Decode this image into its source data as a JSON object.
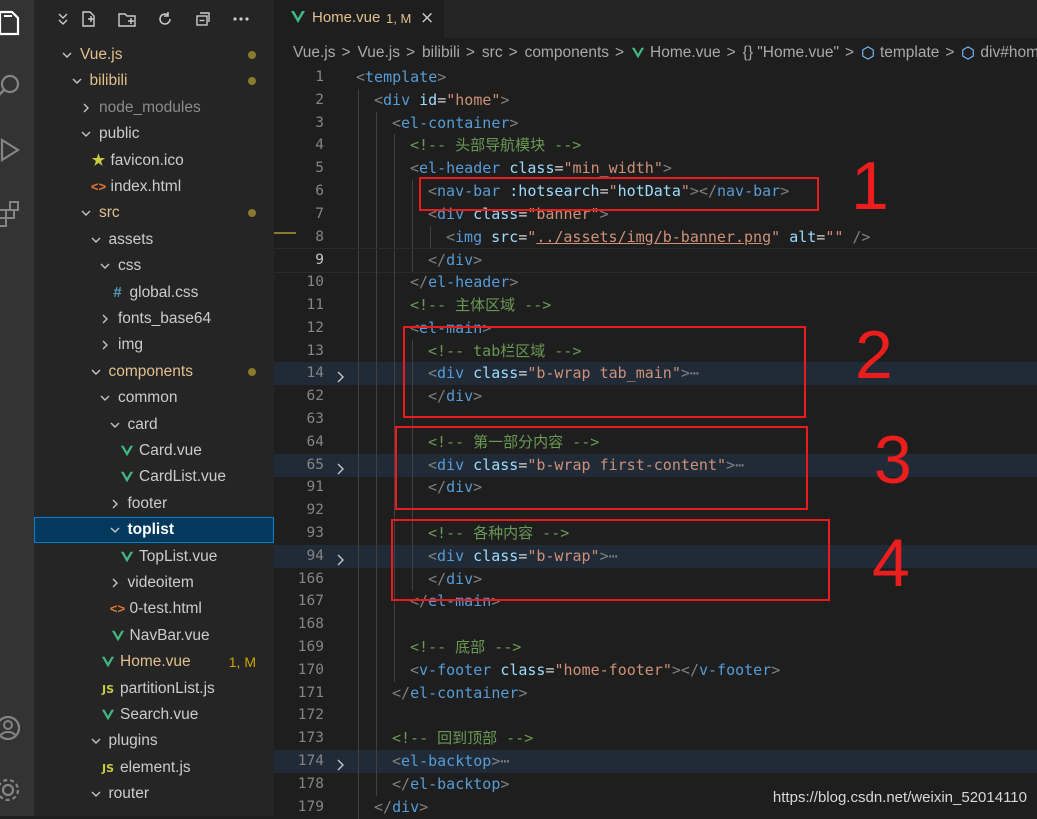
{
  "activity_bar": {
    "icons": [
      "explorer-icon",
      "search-icon",
      "run-debug-icon",
      "extensions-icon",
      "account-icon",
      "manage-gear-icon"
    ]
  },
  "explorer": {
    "toolbar_icons": [
      "collapse-icon",
      "new-file-icon",
      "new-folder-icon",
      "refresh-icon",
      "collapse-all-icon",
      "more-icon"
    ],
    "tree": [
      {
        "label": "Vue.js",
        "type": "folder",
        "open": true,
        "depth": 0,
        "status": "modified",
        "color": "#e2c08d"
      },
      {
        "label": "bilibili",
        "type": "folder",
        "open": true,
        "depth": 1,
        "status": "modified",
        "color": "#e2c08d"
      },
      {
        "label": "node_modules",
        "type": "folder",
        "open": false,
        "depth": 2,
        "color": "#8c8c8c"
      },
      {
        "label": "public",
        "type": "folder",
        "open": true,
        "depth": 2,
        "color": "#cccccc"
      },
      {
        "label": "favicon.ico",
        "type": "file",
        "icon": "star",
        "depth": 3,
        "color": "#cccccc"
      },
      {
        "label": "index.html",
        "type": "file",
        "icon": "html",
        "depth": 3,
        "color": "#cccccc"
      },
      {
        "label": "src",
        "type": "folder",
        "open": true,
        "depth": 2,
        "status": "modified",
        "color": "#e2c08d"
      },
      {
        "label": "assets",
        "type": "folder",
        "open": true,
        "depth": 3,
        "color": "#cccccc"
      },
      {
        "label": "css",
        "type": "folder",
        "open": true,
        "depth": 4,
        "color": "#cccccc"
      },
      {
        "label": "global.css",
        "type": "file",
        "icon": "css",
        "depth": 5,
        "color": "#cccccc"
      },
      {
        "label": "fonts_base64",
        "type": "folder",
        "open": false,
        "depth": 4,
        "color": "#cccccc"
      },
      {
        "label": "img",
        "type": "folder",
        "open": false,
        "depth": 4,
        "color": "#cccccc"
      },
      {
        "label": "components",
        "type": "folder",
        "open": true,
        "depth": 3,
        "status": "modified",
        "color": "#e2c08d"
      },
      {
        "label": "common",
        "type": "folder",
        "open": true,
        "depth": 4,
        "color": "#cccccc"
      },
      {
        "label": "card",
        "type": "folder",
        "open": true,
        "depth": 5,
        "color": "#cccccc"
      },
      {
        "label": "Card.vue",
        "type": "file",
        "icon": "vue",
        "depth": 6,
        "color": "#cccccc"
      },
      {
        "label": "CardList.vue",
        "type": "file",
        "icon": "vue",
        "depth": 6,
        "color": "#cccccc"
      },
      {
        "label": "footer",
        "type": "folder",
        "open": false,
        "depth": 5,
        "color": "#cccccc"
      },
      {
        "label": "toplist",
        "type": "folder",
        "open": true,
        "depth": 5,
        "selected": true,
        "color": "#ffffff"
      },
      {
        "label": "TopList.vue",
        "type": "file",
        "icon": "vue",
        "depth": 6,
        "color": "#cccccc"
      },
      {
        "label": "videoitem",
        "type": "folder",
        "open": false,
        "depth": 5,
        "color": "#cccccc"
      },
      {
        "label": "0-test.html",
        "type": "file",
        "icon": "html",
        "depth": 5,
        "color": "#cccccc"
      },
      {
        "label": "NavBar.vue",
        "type": "file",
        "icon": "vue",
        "depth": 5,
        "color": "#cccccc"
      },
      {
        "label": "Home.vue",
        "type": "file",
        "icon": "vue",
        "depth": 4,
        "color": "#e2c08d",
        "badge": "1, M"
      },
      {
        "label": "partitionList.js",
        "type": "file",
        "icon": "js",
        "depth": 4,
        "color": "#cccccc"
      },
      {
        "label": "Search.vue",
        "type": "file",
        "icon": "vue",
        "depth": 4,
        "color": "#cccccc"
      },
      {
        "label": "plugins",
        "type": "folder",
        "open": true,
        "depth": 3,
        "color": "#cccccc"
      },
      {
        "label": "element.js",
        "type": "file",
        "icon": "js",
        "depth": 4,
        "color": "#cccccc"
      },
      {
        "label": "router",
        "type": "folder",
        "open": true,
        "depth": 3,
        "color": "#cccccc"
      }
    ]
  },
  "tab": {
    "label": "Home.vue",
    "badge": "1, M",
    "close": "×"
  },
  "breadcrumb": [
    "Vue.js",
    "Vue.js",
    "bilibili",
    "src",
    "components",
    "Home.vue",
    "{} \"Home.vue\"",
    "template",
    "div#home"
  ],
  "breadcrumb_sep": ">",
  "code_lines": [
    {
      "n": "1",
      "indent": 0,
      "tokens": [
        [
          "br",
          "<"
        ],
        [
          "tag",
          "template"
        ],
        [
          "br",
          ">"
        ]
      ]
    },
    {
      "n": "2",
      "indent": 1,
      "tokens": [
        [
          "br",
          "<"
        ],
        [
          "tag",
          "div"
        ],
        [
          "txt",
          " "
        ],
        [
          "attr",
          "id"
        ],
        [
          "txt",
          "="
        ],
        [
          "str",
          "\"home\""
        ],
        [
          "br",
          ">"
        ]
      ]
    },
    {
      "n": "3",
      "indent": 2,
      "tokens": [
        [
          "br",
          "<"
        ],
        [
          "tag",
          "el-container"
        ],
        [
          "br",
          ">"
        ]
      ]
    },
    {
      "n": "4",
      "indent": 3,
      "tokens": [
        [
          "com",
          "<!-- 头部导航模块 -->"
        ]
      ]
    },
    {
      "n": "5",
      "indent": 3,
      "tokens": [
        [
          "br",
          "<"
        ],
        [
          "tag",
          "el-header"
        ],
        [
          "txt",
          " "
        ],
        [
          "attr",
          "class"
        ],
        [
          "txt",
          "="
        ],
        [
          "str",
          "\"min_width\""
        ],
        [
          "br",
          ">"
        ]
      ]
    },
    {
      "n": "6",
      "indent": 4,
      "tokens": [
        [
          "br",
          "<"
        ],
        [
          "tag",
          "nav-bar"
        ],
        [
          "txt",
          " "
        ],
        [
          "attr",
          ":hotsearch"
        ],
        [
          "txt",
          "="
        ],
        [
          "str",
          "\""
        ],
        [
          "attr",
          "hotData"
        ],
        [
          "str",
          "\""
        ],
        [
          "br",
          "></"
        ],
        [
          "tag",
          "nav-bar"
        ],
        [
          "br",
          ">"
        ]
      ]
    },
    {
      "n": "7",
      "indent": 4,
      "tokens": [
        [
          "br",
          "<"
        ],
        [
          "tag",
          "div"
        ],
        [
          "txt",
          " "
        ],
        [
          "attr",
          "class"
        ],
        [
          "txt",
          "="
        ],
        [
          "str",
          "\"banner\""
        ],
        [
          "br",
          ">"
        ]
      ]
    },
    {
      "n": "8",
      "indent": 5,
      "tokens": [
        [
          "br",
          "<"
        ],
        [
          "tag",
          "img"
        ],
        [
          "txt",
          " "
        ],
        [
          "attr",
          "src"
        ],
        [
          "txt",
          "="
        ],
        [
          "str",
          "\""
        ],
        [
          "link",
          "../assets/img/b-banner.png"
        ],
        [
          "str",
          "\""
        ],
        [
          "txt",
          " "
        ],
        [
          "attr",
          "alt"
        ],
        [
          "txt",
          "="
        ],
        [
          "str",
          "\"\""
        ],
        [
          "txt",
          " "
        ],
        [
          "br",
          "/>"
        ]
      ]
    },
    {
      "n": "9",
      "indent": 4,
      "cur": true,
      "tokens": [
        [
          "br",
          "</"
        ],
        [
          "tag",
          "div"
        ],
        [
          "br",
          ">"
        ]
      ]
    },
    {
      "n": "10",
      "indent": 3,
      "tokens": [
        [
          "br",
          "</"
        ],
        [
          "tag",
          "el-header"
        ],
        [
          "br",
          ">"
        ]
      ]
    },
    {
      "n": "11",
      "indent": 3,
      "tokens": [
        [
          "com",
          "<!-- 主体区域 -->"
        ]
      ]
    },
    {
      "n": "12",
      "indent": 3,
      "tokens": [
        [
          "br",
          "<"
        ],
        [
          "tag",
          "el-main"
        ],
        [
          "br",
          ">"
        ]
      ]
    },
    {
      "n": "13",
      "indent": 4,
      "tokens": [
        [
          "com",
          "<!-- tab栏区域 -->"
        ]
      ]
    },
    {
      "n": "14",
      "indent": 4,
      "hl": true,
      "fold": true,
      "tokens": [
        [
          "br",
          "<"
        ],
        [
          "tag",
          "div"
        ],
        [
          "txt",
          " "
        ],
        [
          "attr",
          "class"
        ],
        [
          "txt",
          "="
        ],
        [
          "str",
          "\"b-wrap tab_main\""
        ],
        [
          "br",
          ">"
        ],
        [
          "br",
          "⋯"
        ]
      ]
    },
    {
      "n": "62",
      "indent": 4,
      "tokens": [
        [
          "br",
          "</"
        ],
        [
          "tag",
          "div"
        ],
        [
          "br",
          ">"
        ]
      ]
    },
    {
      "n": "63",
      "indent": 4,
      "tokens": []
    },
    {
      "n": "64",
      "indent": 4,
      "tokens": [
        [
          "com",
          "<!-- 第一部分内容 -->"
        ]
      ]
    },
    {
      "n": "65",
      "indent": 4,
      "hl": true,
      "fold": true,
      "tokens": [
        [
          "br",
          "<"
        ],
        [
          "tag",
          "div"
        ],
        [
          "txt",
          " "
        ],
        [
          "attr",
          "class"
        ],
        [
          "txt",
          "="
        ],
        [
          "str",
          "\"b-wrap first-content\""
        ],
        [
          "br",
          ">"
        ],
        [
          "br",
          "⋯"
        ]
      ]
    },
    {
      "n": "91",
      "indent": 4,
      "tokens": [
        [
          "br",
          "</"
        ],
        [
          "tag",
          "div"
        ],
        [
          "br",
          ">"
        ]
      ]
    },
    {
      "n": "92",
      "indent": 4,
      "tokens": []
    },
    {
      "n": "93",
      "indent": 4,
      "tokens": [
        [
          "com",
          "<!-- 各种内容 -->"
        ]
      ]
    },
    {
      "n": "94",
      "indent": 4,
      "hl": true,
      "fold": true,
      "tokens": [
        [
          "br",
          "<"
        ],
        [
          "tag",
          "div"
        ],
        [
          "txt",
          " "
        ],
        [
          "attr",
          "class"
        ],
        [
          "txt",
          "="
        ],
        [
          "str",
          "\"b-wrap\""
        ],
        [
          "br",
          ">"
        ],
        [
          "br",
          "⋯"
        ]
      ]
    },
    {
      "n": "166",
      "indent": 4,
      "tokens": [
        [
          "br",
          "</"
        ],
        [
          "tag",
          "div"
        ],
        [
          "br",
          ">"
        ]
      ]
    },
    {
      "n": "167",
      "indent": 3,
      "tokens": [
        [
          "br",
          "</"
        ],
        [
          "tag",
          "el-main"
        ],
        [
          "br",
          ">"
        ]
      ]
    },
    {
      "n": "168",
      "indent": 3,
      "tokens": []
    },
    {
      "n": "169",
      "indent": 3,
      "tokens": [
        [
          "com",
          "<!-- 底部 -->"
        ]
      ]
    },
    {
      "n": "170",
      "indent": 3,
      "tokens": [
        [
          "br",
          "<"
        ],
        [
          "tag",
          "v-footer"
        ],
        [
          "txt",
          " "
        ],
        [
          "attr",
          "class"
        ],
        [
          "txt",
          "="
        ],
        [
          "str",
          "\"home-footer\""
        ],
        [
          "br",
          "></"
        ],
        [
          "tag",
          "v-footer"
        ],
        [
          "br",
          ">"
        ]
      ]
    },
    {
      "n": "171",
      "indent": 2,
      "tokens": [
        [
          "br",
          "</"
        ],
        [
          "tag",
          "el-container"
        ],
        [
          "br",
          ">"
        ]
      ]
    },
    {
      "n": "172",
      "indent": 2,
      "tokens": []
    },
    {
      "n": "173",
      "indent": 2,
      "tokens": [
        [
          "com",
          "<!-- 回到顶部 -->"
        ]
      ]
    },
    {
      "n": "174",
      "indent": 2,
      "hl": true,
      "fold": true,
      "tokens": [
        [
          "br",
          "<"
        ],
        [
          "tag",
          "el-backtop"
        ],
        [
          "br",
          ">"
        ],
        [
          "br",
          "⋯"
        ]
      ]
    },
    {
      "n": "178",
      "indent": 2,
      "tokens": [
        [
          "br",
          "</"
        ],
        [
          "tag",
          "el-backtop"
        ],
        [
          "br",
          ">"
        ]
      ]
    },
    {
      "n": "179",
      "indent": 1,
      "tokens": [
        [
          "br",
          "</"
        ],
        [
          "tag",
          "div"
        ],
        [
          "br",
          ">"
        ]
      ]
    }
  ],
  "annotations": [
    "1",
    "2",
    "3",
    "4"
  ],
  "watermark": "https://blog.csdn.net/weixin_52014110",
  "colors": {
    "annotation_red": "#e81c1c",
    "modified": "#e2c08d",
    "vue_green": "#41b883",
    "js_yellow": "#cbcb41",
    "html_orange": "#e37933",
    "css_blue": "#519aba"
  }
}
